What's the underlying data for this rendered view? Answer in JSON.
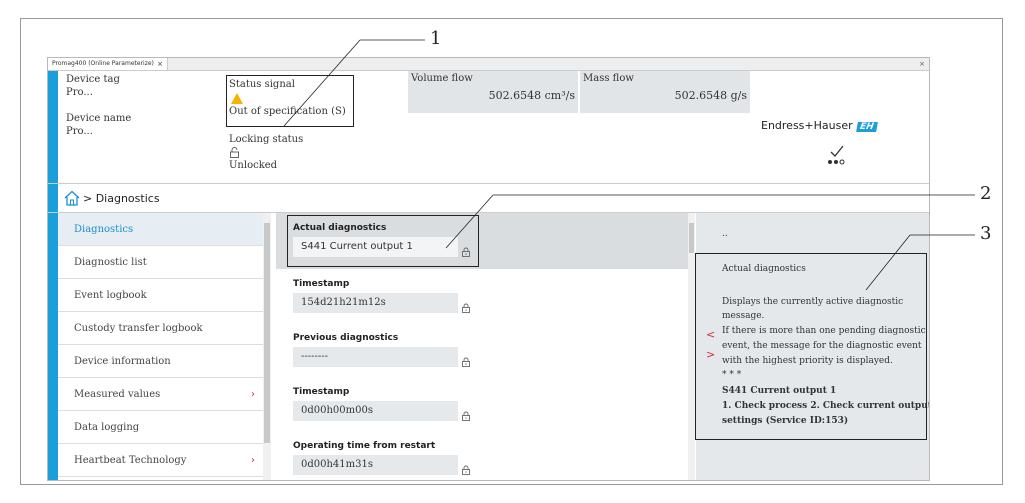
{
  "tab": {
    "title": "Promag400 (Online Parameterize)",
    "close": "×"
  },
  "window": {
    "close": "×"
  },
  "header": {
    "device_tag_label": "Device tag",
    "device_tag_value": "Pro...",
    "device_name_label": "Device name",
    "device_name_value": "Pro...",
    "status_signal_label": "Status signal",
    "status_signal_value": "Out of specification (S)",
    "locking_status_label": "Locking status",
    "locking_status_value": "Unlocked",
    "volume_flow_label": "Volume flow",
    "volume_flow_value": "502.6548 cm³/s",
    "mass_flow_label": "Mass flow",
    "mass_flow_value": "502.6548 g/s",
    "logo_text": "Endress+Hauser",
    "logo_mark": "EH"
  },
  "breadcrumb": {
    "current": "> Diagnostics"
  },
  "nav": {
    "items": [
      {
        "label": "Diagnostics",
        "active": true,
        "submenu": false
      },
      {
        "label": "Diagnostic list",
        "active": false,
        "submenu": false
      },
      {
        "label": "Event logbook",
        "active": false,
        "submenu": false
      },
      {
        "label": "Custody transfer logbook",
        "active": false,
        "submenu": false
      },
      {
        "label": "Device information",
        "active": false,
        "submenu": false
      },
      {
        "label": "Measured values",
        "active": false,
        "submenu": true
      },
      {
        "label": "Data logging",
        "active": false,
        "submenu": false
      },
      {
        "label": "Heartbeat Technology",
        "active": false,
        "submenu": true
      }
    ]
  },
  "fields": [
    {
      "title": "Actual diagnostics",
      "value": "S441 Current output 1"
    },
    {
      "title": "Timestamp",
      "value": "154d21h21m12s"
    },
    {
      "title": "Previous diagnostics",
      "value": "--------"
    },
    {
      "title": "Timestamp",
      "value": "0d00h00m00s"
    },
    {
      "title": "Operating time from restart",
      "value": "0d00h41m31s"
    }
  ],
  "help": {
    "ellipsis": "..",
    "title": "Actual diagnostics",
    "lines": [
      "Displays the currently active diagnostic",
      "message.",
      "If there is more than one pending diagnostic",
      "event, the message for the diagnostic event",
      "with the highest priority is displayed.",
      "* * *"
    ],
    "bold_lines": [
      "S441 Current output 1",
      "1. Check process 2. Check current output",
      "settings (Service ID:153)"
    ],
    "prev": "<",
    "next": ">"
  },
  "callouts": [
    "1",
    "2",
    "3"
  ],
  "colors": {
    "accent": "#1a9fdb",
    "warning": "#f5b400",
    "chevron": "#cc3333"
  },
  "icons": [
    "home-icon",
    "warning-icon",
    "lock-icon",
    "status-ok-icon",
    "chevron-right-icon"
  ]
}
